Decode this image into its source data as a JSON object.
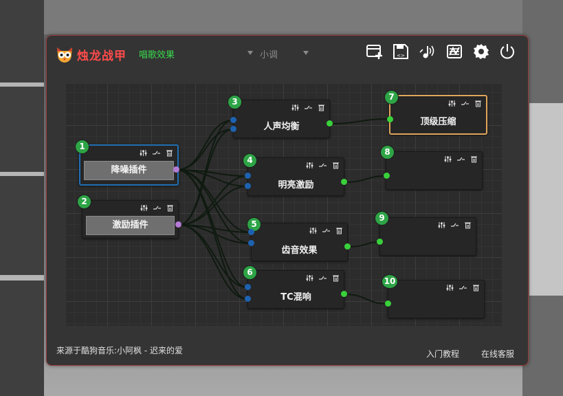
{
  "app": {
    "title": "烛龙战甲",
    "subtitle": "唱歌效果",
    "preset": "小调"
  },
  "toolbar": {
    "icons": [
      "add-window-icon",
      "save-icon",
      "audio-icon",
      "equalizer-icon",
      "settings-icon",
      "power-icon"
    ]
  },
  "nodes": [
    {
      "id": "1",
      "label": "降噪插件"
    },
    {
      "id": "2",
      "label": "激励插件"
    },
    {
      "id": "3",
      "label": "人声均衡"
    },
    {
      "id": "4",
      "label": "明亮激励"
    },
    {
      "id": "5",
      "label": "齿音效果"
    },
    {
      "id": "6",
      "label": "TC混响"
    },
    {
      "id": "7",
      "label": "顶级压缩"
    },
    {
      "id": "8",
      "label": ""
    },
    {
      "id": "9",
      "label": ""
    },
    {
      "id": "10",
      "label": ""
    }
  ],
  "footer": {
    "source": "来源于酷狗音乐:小阿枫 - 迟来的爱",
    "tutorial": "入门教程",
    "support": "在线客服"
  },
  "colors": {
    "accent_red": "#ff4b4b",
    "accent_green": "#39d94c",
    "badge_green": "#2ea446",
    "port_input": "#1d62b0",
    "port_output": "#39d13b",
    "port_source": "#b57ad6",
    "selected_blue": "#1f6fb3",
    "selected_orange": "#e0a55a"
  }
}
